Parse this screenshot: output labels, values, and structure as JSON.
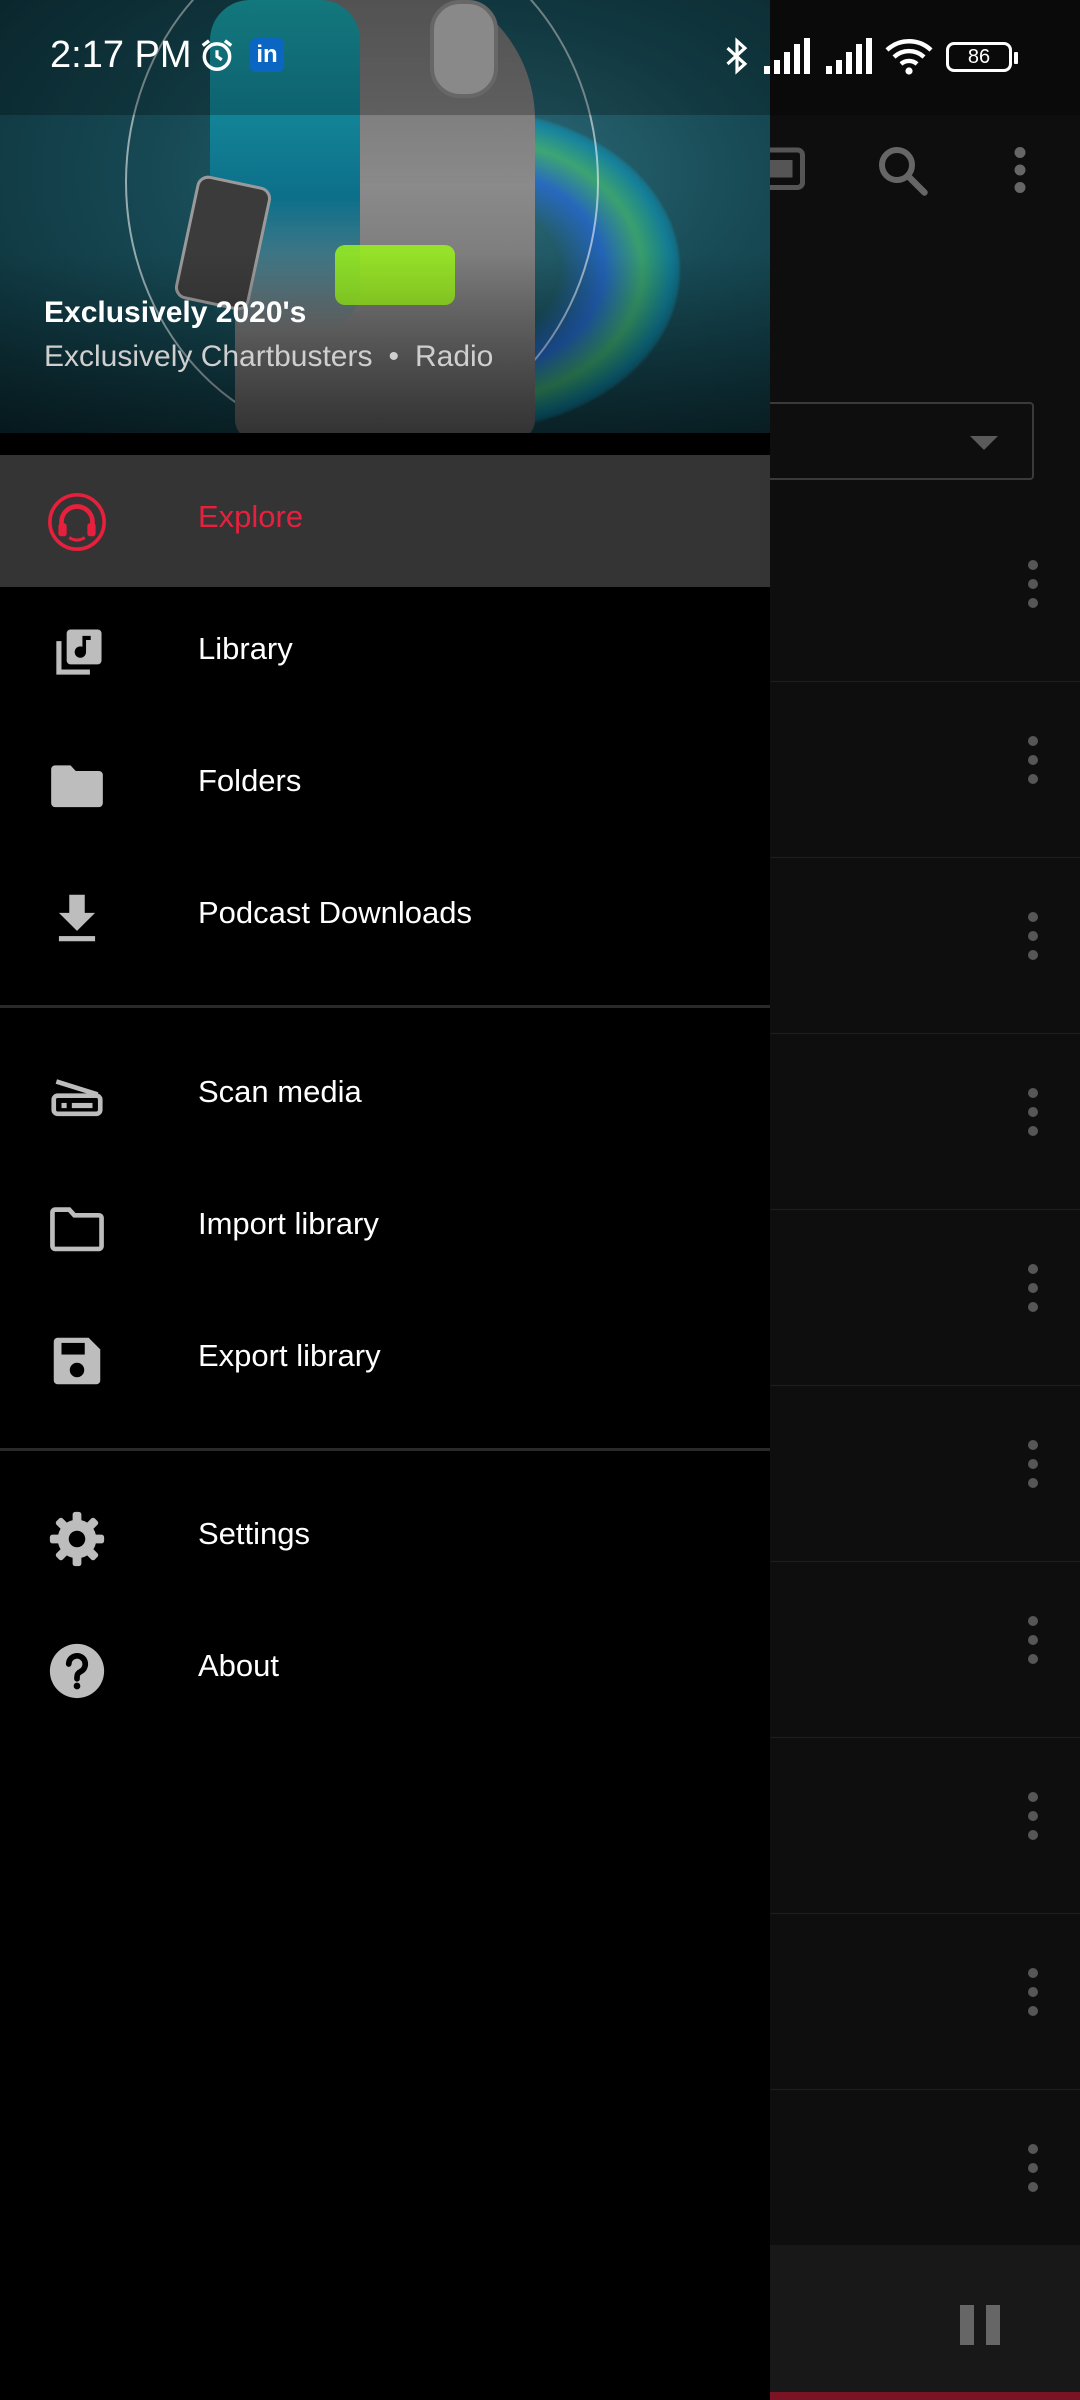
{
  "status_bar": {
    "time": "2:17 PM",
    "linkedin_badge": "in",
    "battery": "86",
    "icons": [
      "alarm-icon",
      "linkedin-icon",
      "bluetooth-icon",
      "signal-icon",
      "signal-icon",
      "wifi-icon",
      "battery-icon"
    ]
  },
  "drawer": {
    "now_playing": {
      "title": "Exclusively 2020's",
      "subtitle": "Exclusively Chartbusters",
      "separator": "•",
      "type": "Radio"
    },
    "accent_color": "#e8203d",
    "primary_items": [
      {
        "label": "Explore",
        "icon": "headphones-icon",
        "selected": true
      },
      {
        "label": "Library",
        "icon": "music-library-icon"
      },
      {
        "label": "Folders",
        "icon": "folder-icon"
      },
      {
        "label": "Podcast Downloads",
        "icon": "download-icon"
      }
    ],
    "tool_items": [
      {
        "label": "Scan media",
        "icon": "scanner-icon"
      },
      {
        "label": "Import library",
        "icon": "folder-outline-icon"
      },
      {
        "label": "Export library",
        "icon": "save-icon"
      }
    ],
    "misc_items": [
      {
        "label": "Settings",
        "icon": "gear-icon"
      },
      {
        "label": "About",
        "icon": "help-icon"
      }
    ]
  },
  "background_app": {
    "toolbar_icons": [
      "cast-icon",
      "search-icon",
      "more-vert-icon"
    ],
    "player_state": "playing"
  }
}
